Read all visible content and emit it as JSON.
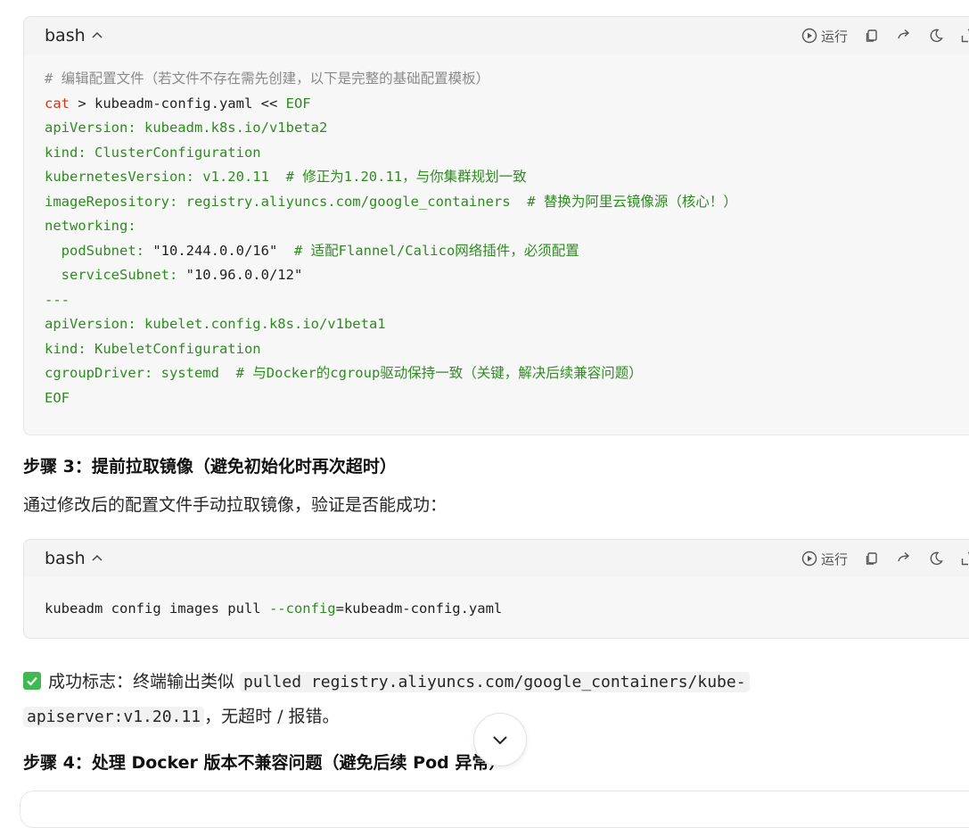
{
  "block1": {
    "lang": "bash",
    "run_label": "运行",
    "lines": [
      [
        {
          "t": "# 编辑配置文件（若文件不存在需先创建，以下是完整的基础配置模板）",
          "c": "c-comment"
        }
      ],
      [
        {
          "t": "cat",
          "c": "c-cmd"
        },
        {
          "t": " > kubeadm-config.yaml << ",
          "c": "c-op"
        },
        {
          "t": "EOF",
          "c": "c-kw"
        }
      ],
      [
        {
          "t": "apiVersion: kubeadm.k8s.io/v1beta2",
          "c": "c-yaml"
        }
      ],
      [
        {
          "t": "kind: ClusterConfiguration",
          "c": "c-yaml"
        }
      ],
      [
        {
          "t": "kubernetesVersion: v1.20.11  # 修正为1.20.11，与你集群规划一致",
          "c": "c-yaml"
        }
      ],
      [
        {
          "t": "imageRepository: registry.aliyuncs.com/google_containers  # 替换为阿里云镜像源（核心！）",
          "c": "c-yaml"
        }
      ],
      [
        {
          "t": "networking:",
          "c": "c-yaml"
        }
      ],
      [
        {
          "t": "  podSubnet: ",
          "c": "c-yaml"
        },
        {
          "t": "\"10.244.0.0/16\"",
          "c": "c-str"
        },
        {
          "t": "  # 适配Flannel/Calico网络插件，必须配置",
          "c": "c-yaml"
        }
      ],
      [
        {
          "t": "  serviceSubnet: ",
          "c": "c-yaml"
        },
        {
          "t": "\"10.96.0.0/12\"",
          "c": "c-str"
        }
      ],
      [
        {
          "t": "---",
          "c": "c-yaml"
        }
      ],
      [
        {
          "t": "apiVersion: kubelet.config.k8s.io/v1beta1",
          "c": "c-yaml"
        }
      ],
      [
        {
          "t": "kind: KubeletConfiguration",
          "c": "c-yaml"
        }
      ],
      [
        {
          "t": "cgroupDriver: systemd  # 与Docker的cgroup驱动保持一致（关键，解决后续兼容问题）",
          "c": "c-yaml"
        }
      ],
      [
        {
          "t": "EOF",
          "c": "c-yaml"
        }
      ]
    ]
  },
  "step3": {
    "heading": "步骤 3：提前拉取镜像（避免初始化时再次超时）",
    "text": "通过修改后的配置文件手动拉取镜像，验证是否能成功："
  },
  "block2": {
    "lang": "bash",
    "run_label": "运行",
    "lines": [
      [
        {
          "t": "kubeadm config images pull ",
          "c": "c-op"
        },
        {
          "t": "--config",
          "c": "c-kw"
        },
        {
          "t": "=kubeadm-config.yaml",
          "c": "c-op"
        }
      ]
    ]
  },
  "success": {
    "label": "成功标志：终端输出类似 ",
    "code": "pulled registry.aliyuncs.com/google_containers/kube-",
    "code2": "apiserver:v1.20.11",
    "tail": "，无超时 / 报错。"
  },
  "step4": {
    "heading": "步骤 4：处理 Docker 版本不兼容问题（避免后续 Pod 异常）"
  },
  "colors": {
    "check": "#3fb950",
    "comment": "#8a8a8a",
    "yaml": "#2e8b1f",
    "cmd": "#d1361d"
  }
}
